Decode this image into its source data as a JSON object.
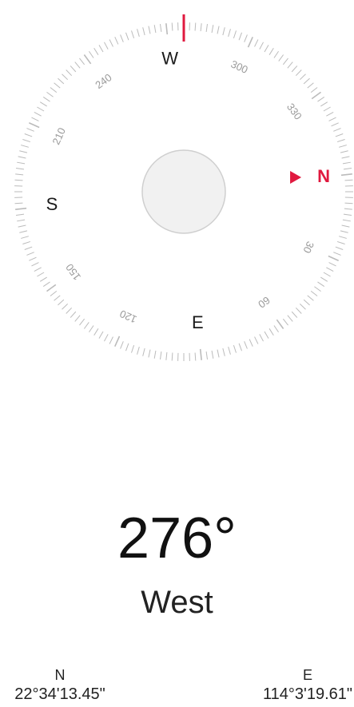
{
  "compass": {
    "heading_deg": 276,
    "cardinals": {
      "N": "N",
      "E": "E",
      "S": "S",
      "W": "W"
    },
    "dial_numbers": [
      "30",
      "60",
      "120",
      "150",
      "210",
      "240",
      "300",
      "330"
    ],
    "colors": {
      "accent": "#e0193f",
      "tick": "#bbbbbb",
      "center_fill": "#f1f1f1",
      "center_stroke": "#cfcfcf"
    },
    "north_marker_icon": "triangle-right-icon"
  },
  "reading": {
    "degrees_text": "276°",
    "direction_text": "West"
  },
  "coordinates": {
    "latitude_label": "N",
    "latitude_value": "22°34'13.45\"",
    "longitude_label": "E",
    "longitude_value": "114°3'19.61\""
  }
}
